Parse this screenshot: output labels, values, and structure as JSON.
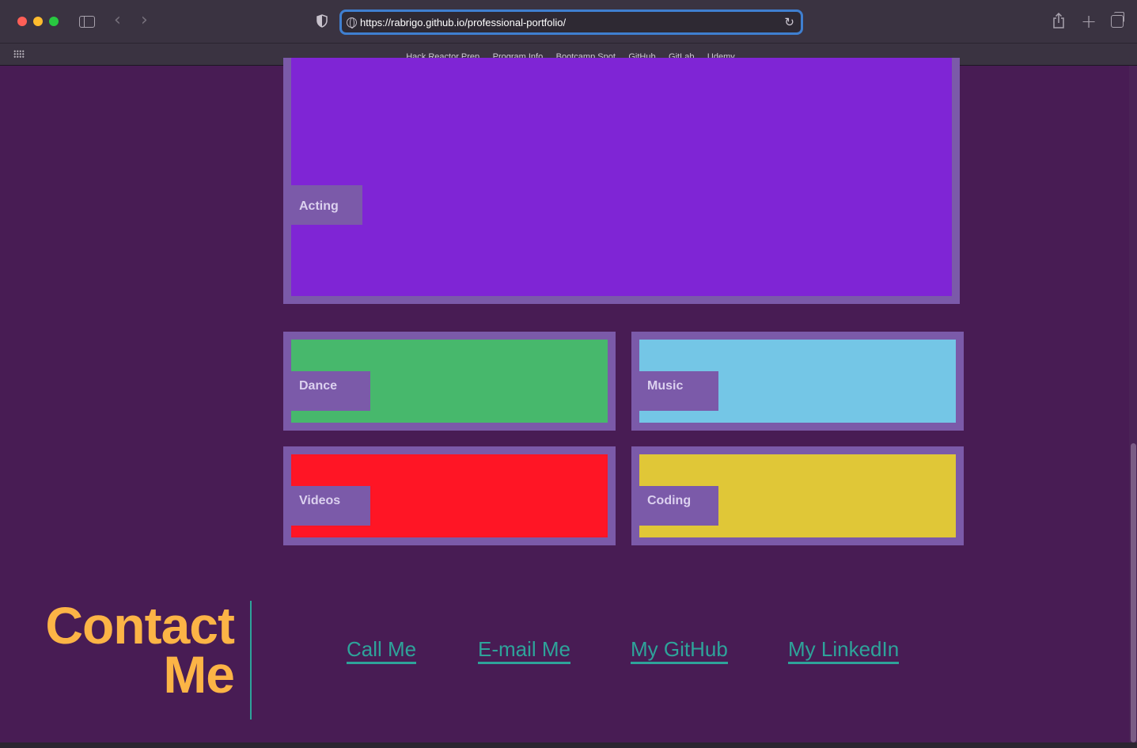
{
  "browser": {
    "url": "https://rabrigo.github.io/professional-portfolio/",
    "favorites": [
      "Hack Reactor Prep",
      "Program Info",
      "Bootcamp Spot",
      "GitHub",
      "GitLab",
      "Udemy"
    ]
  },
  "portfolio": {
    "featured": {
      "label": "Acting",
      "color": "#7f25d5"
    },
    "cards": [
      {
        "label": "Dance",
        "color": "#47b86c"
      },
      {
        "label": "Music",
        "color": "#74c6e6"
      },
      {
        "label": "Videos",
        "color": "#ff1525"
      },
      {
        "label": "Coding",
        "color": "#e0c737"
      }
    ]
  },
  "contact": {
    "title_line1": "Contact",
    "title_line2": "Me",
    "links": [
      "Call Me",
      "E-mail Me",
      "My GitHub",
      "My LinkedIn"
    ],
    "accent": "#fcb446",
    "link_color": "#2ea39a"
  },
  "icons": {
    "traffic_lights": [
      "close-icon",
      "minimize-icon",
      "zoom-icon"
    ],
    "toolbar": [
      "sidebar-icon",
      "back-icon",
      "forward-icon",
      "privacy-shield-icon",
      "globe-icon",
      "reload-icon",
      "share-icon",
      "new-tab-icon",
      "tab-overview-icon"
    ]
  }
}
